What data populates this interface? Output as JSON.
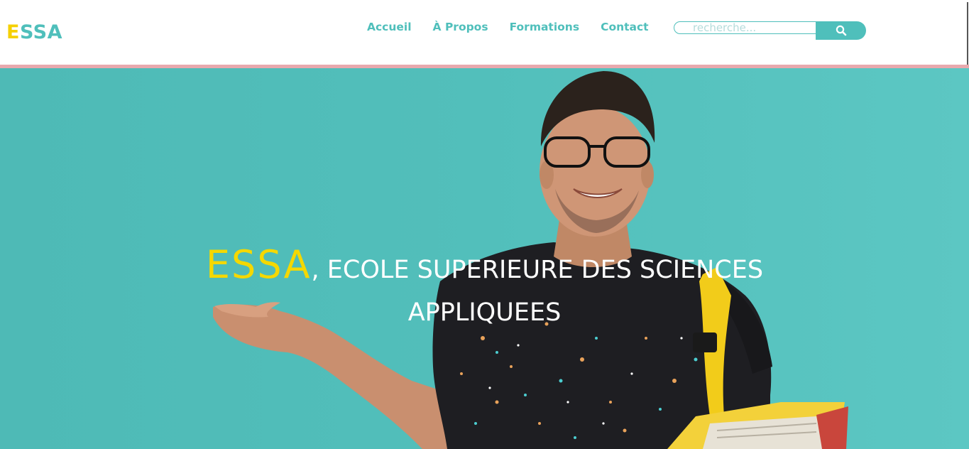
{
  "logo": {
    "first_letter": "E",
    "rest": "SSA"
  },
  "nav": {
    "items": [
      {
        "label": "Accueil"
      },
      {
        "label": "À Propos"
      },
      {
        "label": "Formations"
      },
      {
        "label": "Contact"
      }
    ]
  },
  "search": {
    "placeholder": "recherche...",
    "button_icon": "search-icon"
  },
  "hero": {
    "brand": "ESSA",
    "title_rest": ", ECOLE SUPERIEURE DES SCIENCES APPLIQUEES"
  },
  "colors": {
    "accent_teal": "#4fbfbb",
    "brand_yellow": "#f5d000",
    "header_border": "#e8a9ae"
  }
}
